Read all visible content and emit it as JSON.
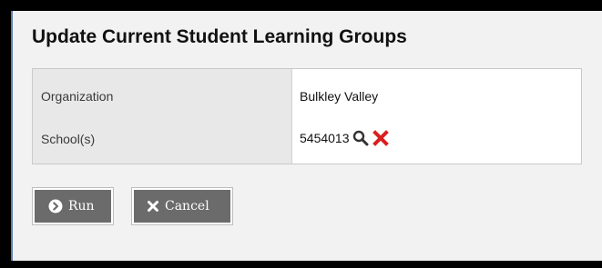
{
  "dialog": {
    "title": "Update Current Student Learning Groups"
  },
  "params": {
    "organization_label": "Organization",
    "organization_value": "Bulkley Valley",
    "schools_label": "School(s)",
    "schools_value": "5454013"
  },
  "icons": {
    "search": "magnifier-icon",
    "clear": "red-x-icon",
    "run": "circle-arrow-right-icon",
    "cancel": "x-icon"
  },
  "colors": {
    "clear_icon": "#d9201f",
    "button_bg": "#6b6b6b"
  },
  "actions": {
    "run_label": "Run",
    "cancel_label": "Cancel"
  }
}
